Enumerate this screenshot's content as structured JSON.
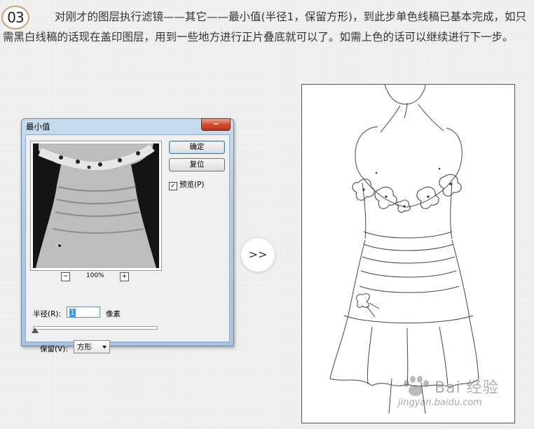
{
  "step": {
    "number": "03"
  },
  "paragraph": {
    "text": "对刚才的图层执行滤镜——其它——最小值(半径1，保留方形)，到此步单色线稿已基本完成，如只需黑白线稿的话现在盖印图层，用到一些地方进行正片叠底就可以了。如需上色的话可以继续进行下一步。"
  },
  "dialog": {
    "title": "最小值",
    "ok_label": "确定",
    "reset_label": "复位",
    "preview_checkbox": {
      "label": "预览(P)",
      "checked": true,
      "mark": "✓"
    },
    "zoom": {
      "minus": "−",
      "value": "100%",
      "plus": "+"
    },
    "radius": {
      "label": "半径(R):",
      "value": "1",
      "unit": "像素",
      "slider_fraction": 0.0
    },
    "preserve": {
      "label": "保留(V):",
      "selected": "方形"
    }
  },
  "next_arrow": ">>",
  "watermark": {
    "brand": "Bai 经验",
    "url": "jingyan.baidu.com"
  }
}
